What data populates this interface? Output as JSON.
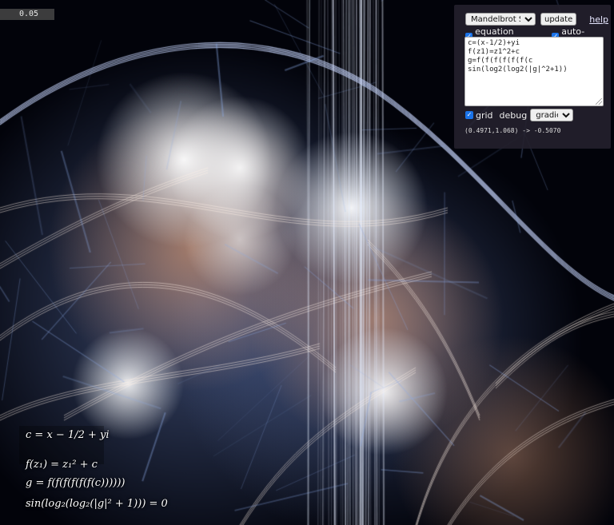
{
  "fps": {
    "value": "0.05"
  },
  "panel": {
    "fractal_select": {
      "selected": "Mandelbrot Set"
    },
    "update_label": "update",
    "help_label": "help",
    "equation_preview": {
      "label": "equation preview",
      "checked": true
    },
    "auto_update": {
      "label": "auto-update",
      "checked": true
    },
    "equation_text": "c=(x-1/2)+yi\nf(z1)=z1^2+c\ng=f(f(f(f(f(f(c\nsin(log2(log2(|g|^2+1))",
    "grid": {
      "label": "grid",
      "checked": true
    },
    "debug_label": "debug",
    "debug_select": {
      "selected": "gradient"
    },
    "readout": "(0.4971,1.068) -> -0.5070"
  },
  "equations": [
    "c = x − 1/2 + yi",
    "f(z₁) = z₁² + c",
    "g = f(f(f(f(f(f(c))))))",
    "sin(log₂(log₂(|g|² + 1))) = 0"
  ],
  "colors": {
    "background": "#000000",
    "bright": "#ffffff",
    "cool": "#6e88c8",
    "warm": "#c89070",
    "panel": "#24202c"
  }
}
